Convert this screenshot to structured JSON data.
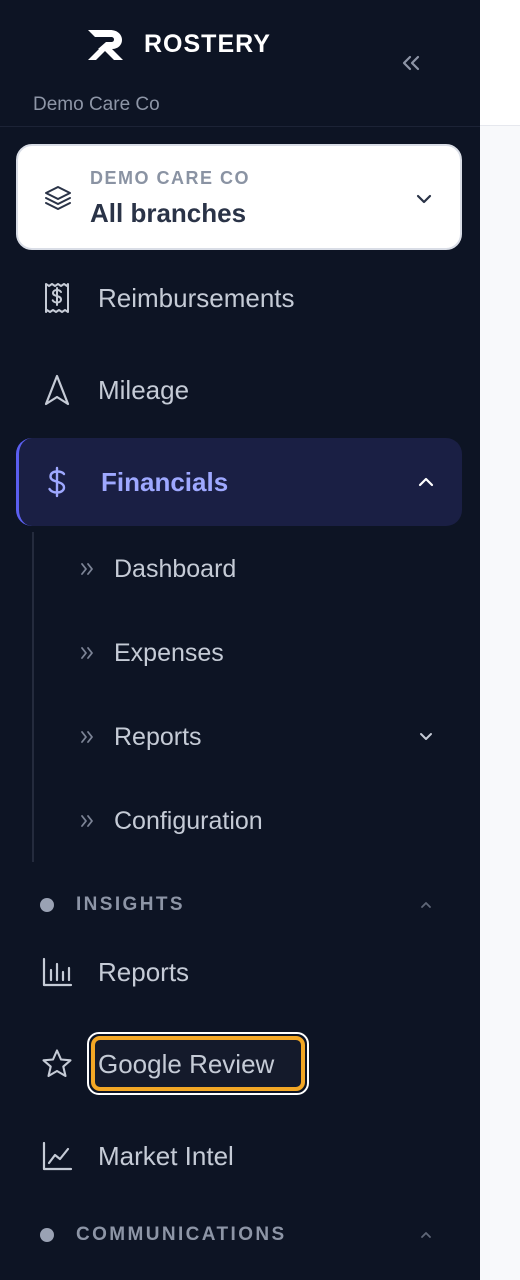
{
  "brand": {
    "name": "ROSTERY",
    "logo": "rostery-r-logo"
  },
  "header": {
    "org_name": "Demo Care Co",
    "collapse_icon": "double-chevron-left-icon"
  },
  "branch_selector": {
    "org": "DEMO CARE CO",
    "value": "All branches",
    "icon": "layers-icon",
    "chevron": "chevron-down-icon"
  },
  "nav": {
    "reimbursements": {
      "label": "Reimbursements",
      "icon": "receipt-dollar-icon"
    },
    "mileage": {
      "label": "Mileage",
      "icon": "navigation-arrow-icon"
    },
    "financials": {
      "label": "Financials",
      "icon": "dollar-sign-icon",
      "expanded": true,
      "children": [
        {
          "label": "Dashboard"
        },
        {
          "label": "Expenses"
        },
        {
          "label": "Reports",
          "has_submenu": true
        },
        {
          "label": "Configuration"
        }
      ]
    }
  },
  "sections": {
    "insights": {
      "title": "INSIGHTS",
      "items": [
        {
          "label": "Reports",
          "icon": "bar-chart-icon"
        },
        {
          "label": "Google Review",
          "icon": "star-icon",
          "focused": true
        },
        {
          "label": "Market Intel",
          "icon": "line-chart-icon"
        }
      ]
    },
    "communications": {
      "title": "COMMUNICATIONS"
    }
  },
  "colors": {
    "sidebar_bg": "#0d1424",
    "active_bg": "#1a1f44",
    "active_accent": "#5b5ff0",
    "active_text": "#9ea8ff",
    "focus_ring": "#f3a725"
  }
}
